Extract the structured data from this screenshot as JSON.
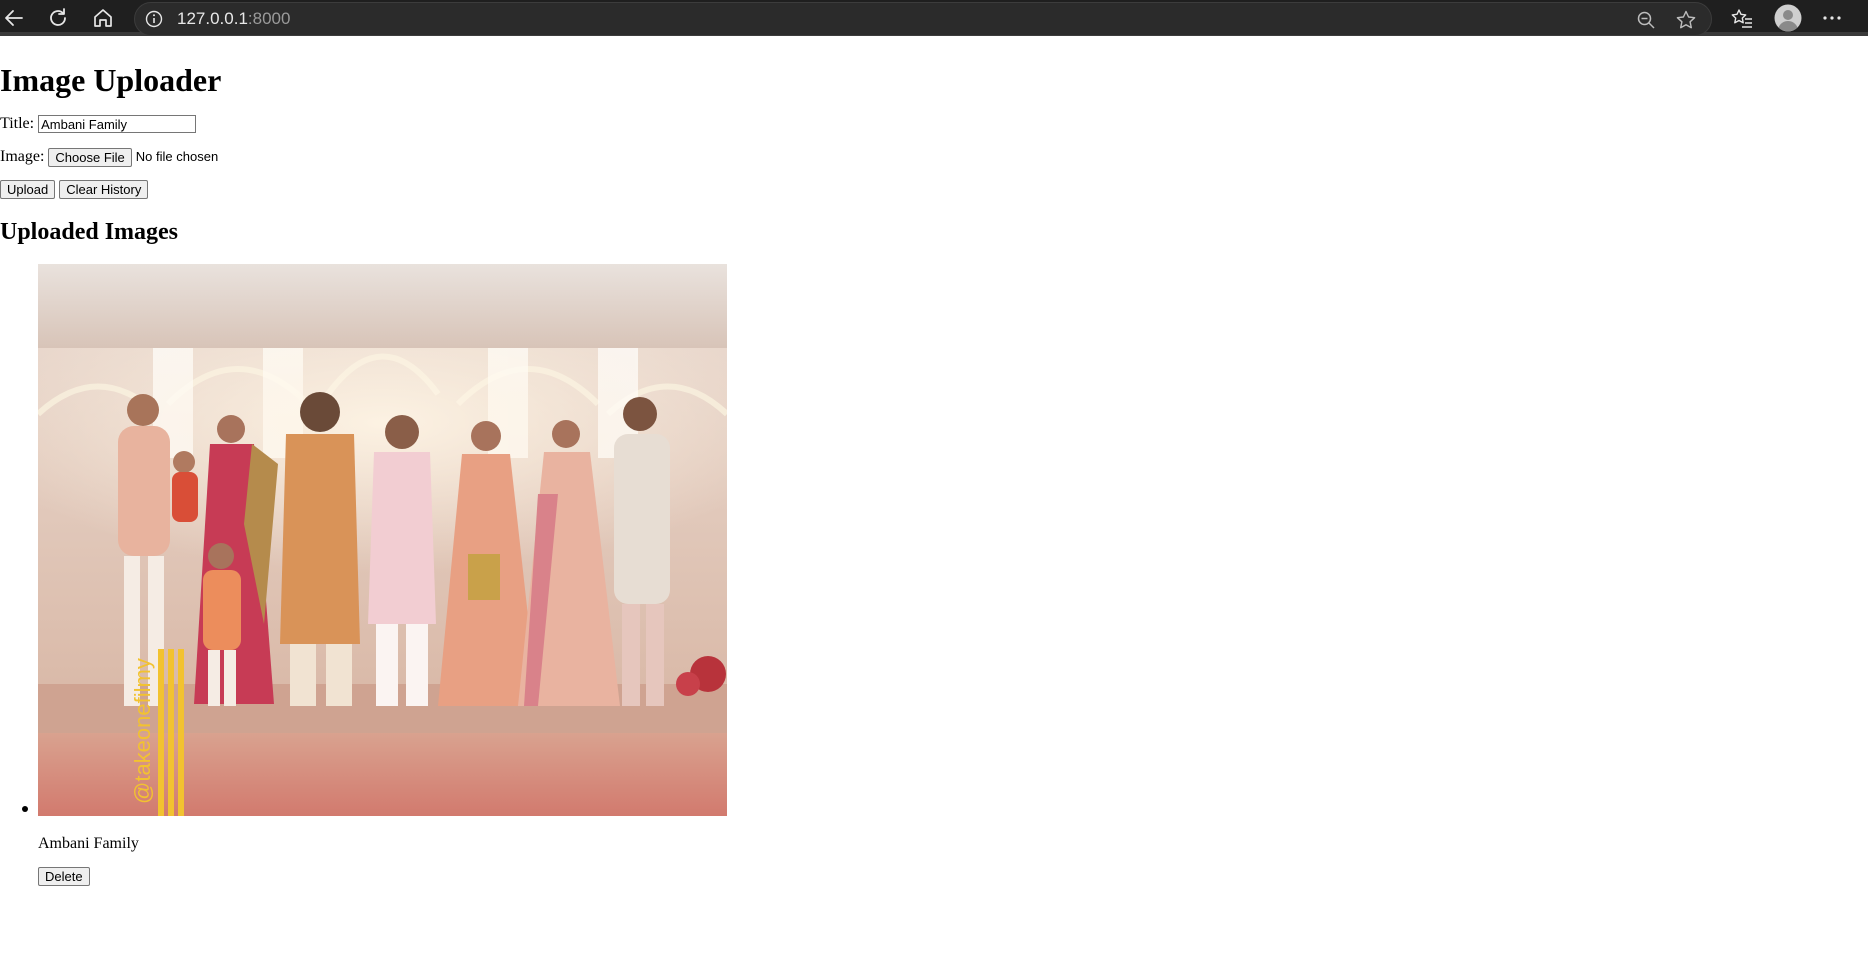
{
  "browser": {
    "url_host": "127.0.0.1",
    "url_port": ":8000",
    "icons": {
      "back": "back-arrow-icon",
      "reload": "reload-icon",
      "home": "home-icon",
      "info": "info-icon",
      "zoom": "zoom-out-icon",
      "favorite": "star-icon",
      "favorites": "favorites-icon",
      "profile": "profile-icon",
      "menu": "more-menu-icon"
    }
  },
  "page": {
    "title": "Image Uploader",
    "form": {
      "title_label": "Title:",
      "title_value": "Ambani Family",
      "image_label": "Image:",
      "choose_file_label": "Choose File",
      "file_status": "No file chosen",
      "upload_label": "Upload",
      "clear_history_label": "Clear History"
    },
    "uploaded_heading": "Uploaded Images",
    "images": [
      {
        "caption": "Ambani Family",
        "delete_label": "Delete",
        "watermark": "@takeonefilmy"
      }
    ]
  },
  "colors": {
    "chrome_bg": "#1f1f1f",
    "url_bg": "#2b2b2b",
    "url_text": "#e8e8e8",
    "url_port": "#9a9a9a",
    "button_bg": "#efefef",
    "watermark": "#f2c230"
  }
}
